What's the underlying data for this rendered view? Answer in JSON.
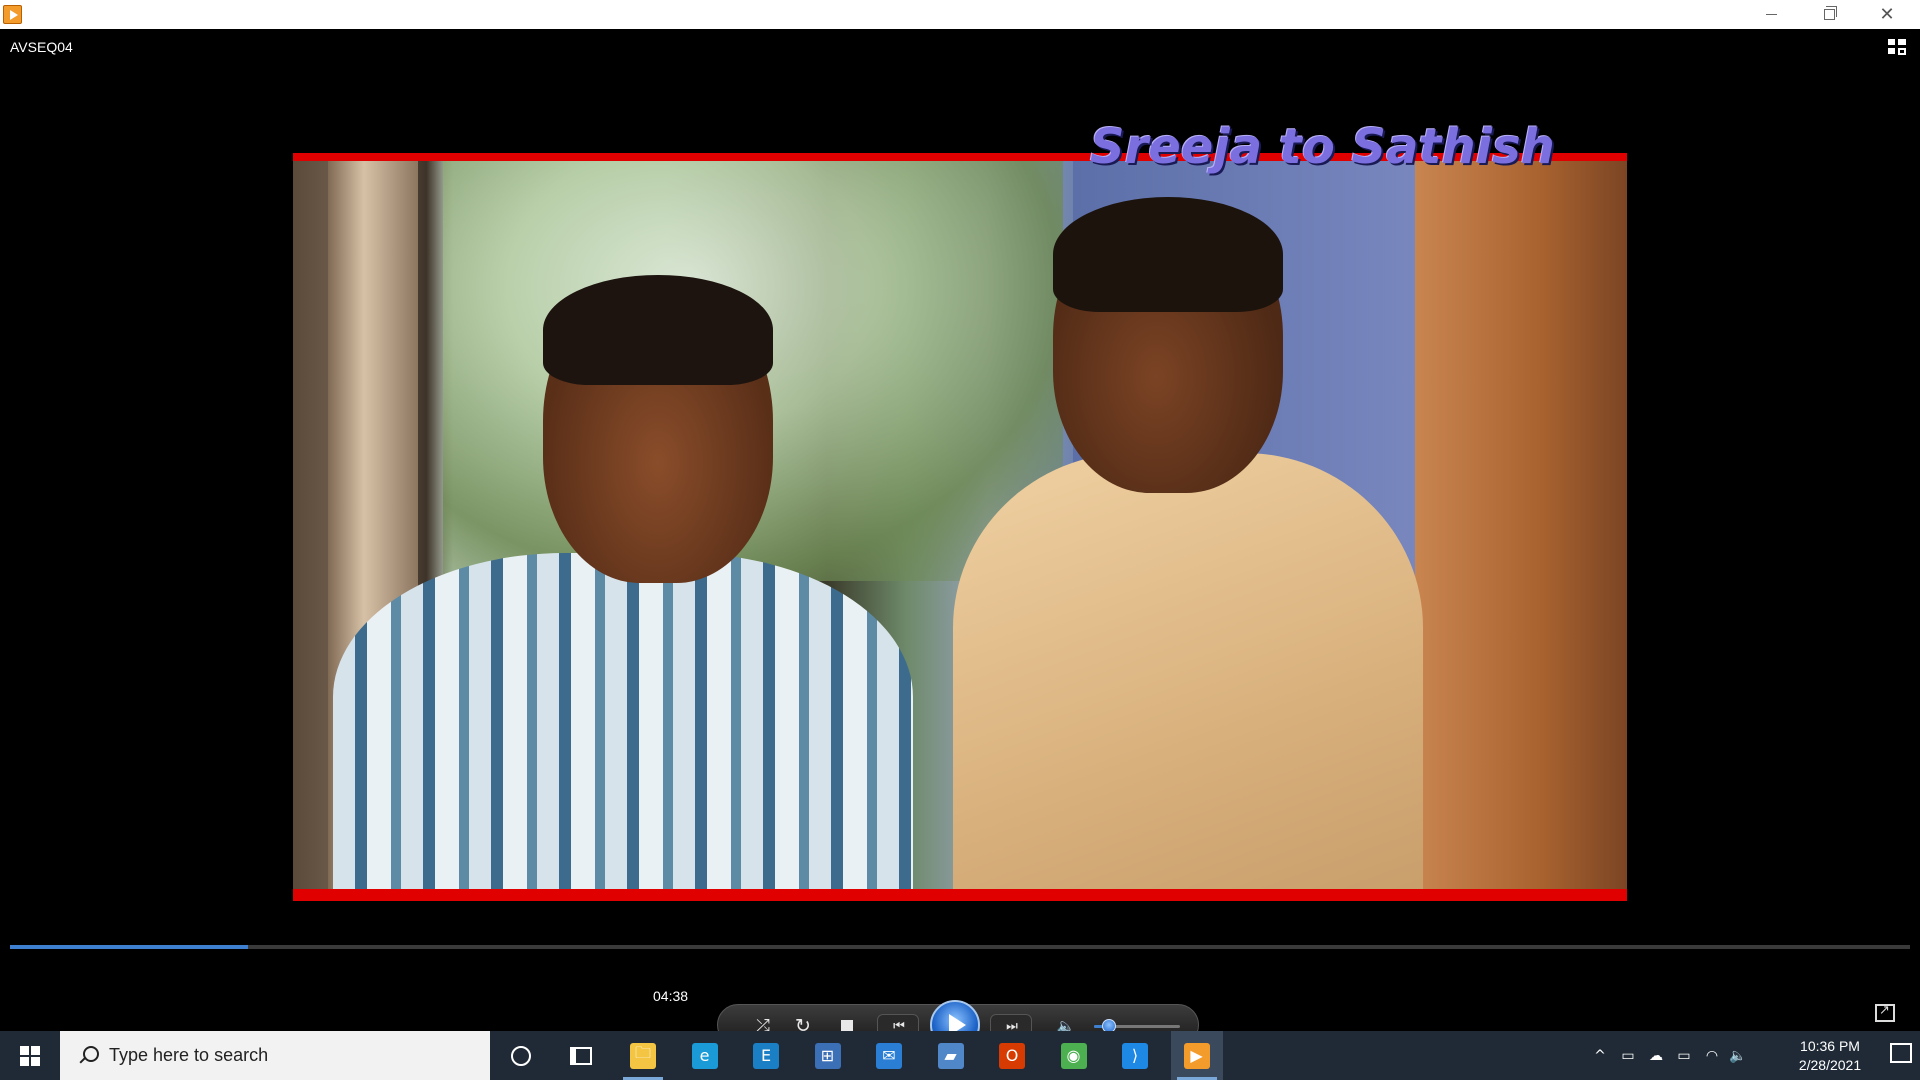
{
  "window": {
    "controls": {
      "minimize": "—",
      "restore": "❐",
      "close": "✕"
    }
  },
  "player": {
    "media_title": "AVSEQ04",
    "video_caption": "Sreeja to Sathish",
    "seek_progress": 0.125,
    "timecode": "04:38",
    "volume_level": 0.18,
    "buttons": {
      "shuffle": "⤮",
      "repeat": "↻",
      "previous": "⏮",
      "next": "⏭",
      "mute": "🔈"
    },
    "colors": {
      "accent": "#3f7fd0",
      "caption": "#7b6fe0",
      "border_red": "#e00000"
    }
  },
  "taskbar": {
    "search_placeholder": "Type here to search",
    "apps": [
      {
        "name": "file-explorer",
        "glyph": "🗀",
        "color": "#f4c542",
        "active": true
      },
      {
        "name": "edge",
        "glyph": "e",
        "color": "#1a9bd7",
        "active": false
      },
      {
        "name": "app-e",
        "glyph": "E",
        "color": "#1a7fc4",
        "active": false
      },
      {
        "name": "store",
        "glyph": "⊞",
        "color": "#3b6fb6",
        "active": false
      },
      {
        "name": "mail",
        "glyph": "✉",
        "color": "#2a7fd4",
        "active": false
      },
      {
        "name": "remote",
        "glyph": "▰",
        "color": "#4f87c9",
        "active": false
      },
      {
        "name": "office",
        "glyph": "O",
        "color": "#d83b01",
        "active": false
      },
      {
        "name": "chrome",
        "glyph": "◉",
        "color": "#4caf50",
        "active": false
      },
      {
        "name": "vscode",
        "glyph": "⟩",
        "color": "#1e88e5",
        "active": false
      },
      {
        "name": "media-player",
        "glyph": "▶",
        "color": "#f39c2c",
        "active": true
      }
    ],
    "tray": {
      "chevron": "^",
      "time": "10:36 PM",
      "date": "2/28/2021"
    }
  }
}
